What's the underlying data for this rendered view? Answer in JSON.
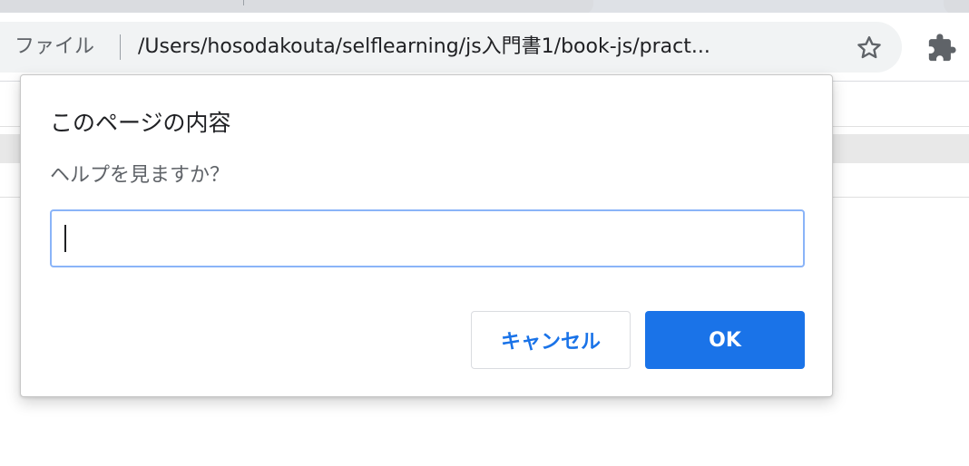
{
  "browser": {
    "site_label": "ファイル",
    "url": "/Users/hosodakouta/selflearning/js入門書1/book-js/pract..."
  },
  "icons": {
    "bookmark": "star-icon",
    "extensions": "puzzle-icon"
  },
  "dialog": {
    "title": "このページの内容",
    "message": "ヘルプを見ますか？",
    "input_value": "",
    "cancel_label": "キャンセル",
    "ok_label": "OK"
  },
  "colors": {
    "accent": "#1a73e8",
    "focus_ring": "#8ab4f8",
    "omnibox_bg": "#f1f3f4"
  }
}
